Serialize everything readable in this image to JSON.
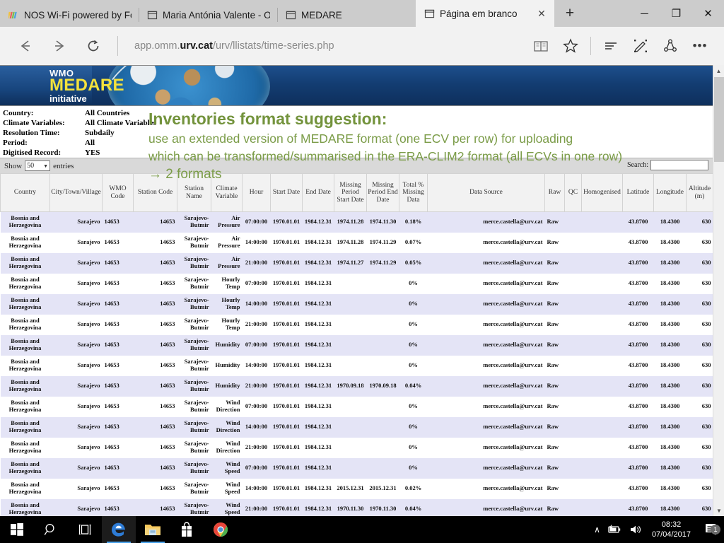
{
  "browser": {
    "tabs": [
      {
        "title": "NOS Wi-Fi powered by Fon",
        "icon": "colored-stripes-favicon",
        "active": false
      },
      {
        "title": "Maria Antónia Valente - Ou",
        "icon": "page-favicon",
        "active": false
      },
      {
        "title": "MEDARE",
        "icon": "page-favicon",
        "active": false
      },
      {
        "title": "Página em branco",
        "icon": "page-favicon",
        "active": true
      }
    ],
    "tab_close_label": "✕",
    "new_tab_label": "+",
    "window_controls": {
      "minimize": "─",
      "maximize": "❐",
      "close": "✕"
    },
    "nav": {
      "back": "back-arrow",
      "forward": "forward-arrow",
      "refresh": "refresh-arrow"
    },
    "address": {
      "prefix": "app.omm.",
      "bold": "urv.cat",
      "suffix": "/urv/llistats/time-series.php"
    },
    "toolbar_icons": [
      "reading-view-icon",
      "favorites-star-icon",
      "hub-icon",
      "web-note-icon",
      "share-icon",
      "more-icon"
    ],
    "more_label": "•••"
  },
  "banner": {
    "wmo": "WMO",
    "medare": "MEDARE",
    "initiative": "initiative"
  },
  "filters": [
    {
      "label": "Country:",
      "value": "All Countries"
    },
    {
      "label": "Climate Variables:",
      "value": "All Climate Variables"
    },
    {
      "label": "Resolution Time:",
      "value": "Subdaily"
    },
    {
      "label": "Period:",
      "value": "All"
    },
    {
      "label": "Digitised Record:",
      "value": "YES"
    }
  ],
  "overlay": {
    "title": "Inventories format suggestion:",
    "line1": "use an extended version of MEDARE format (one ECV per row) for uploading",
    "line2": "which can be transformed/summarised in the ERA-CLIM2 format (all ECVs in one row)",
    "line3": "→ 2 formats",
    "color": "#7b9c48"
  },
  "datatable": {
    "show_label": "Show",
    "entries_label": "entries",
    "page_length": "50",
    "caret": "▼",
    "search_label": "Search:",
    "search_value": "",
    "columns": [
      "Country",
      "City/Town/Village",
      "WMO Code",
      "Station Code",
      "Station Name",
      "Climate Variable",
      "Hour",
      "Start Date",
      "End Date",
      "Missing Period Start Date",
      "Missing Period End Date",
      "Total % Missing Data",
      "Data Source",
      "Raw",
      "QC",
      "Homogenised",
      "Latitude",
      "Longitude",
      "Altitude (m)"
    ],
    "rows": [
      [
        "Bosnia and Herzegovina",
        "Sarajevo",
        "14653",
        "14653",
        "Sarajevo-Butmir",
        "Air Pressure",
        "07:00:00",
        "1970.01.01",
        "1984.12.31",
        "1974.11.28",
        "1974.11.30",
        "0.18%",
        "merce.castella@urv.cat",
        "Raw",
        "",
        "",
        "43.8700",
        "18.4300",
        "630"
      ],
      [
        "Bosnia and Herzegovina",
        "Sarajevo",
        "14653",
        "14653",
        "Sarajevo-Butmir",
        "Air Pressure",
        "14:00:00",
        "1970.01.01",
        "1984.12.31",
        "1974.11.28",
        "1974.11.29",
        "0.07%",
        "merce.castella@urv.cat",
        "Raw",
        "",
        "",
        "43.8700",
        "18.4300",
        "630"
      ],
      [
        "Bosnia and Herzegovina",
        "Sarajevo",
        "14653",
        "14653",
        "Sarajevo-Butmir",
        "Air Pressure",
        "21:00:00",
        "1970.01.01",
        "1984.12.31",
        "1974.11.27",
        "1974.11.29",
        "0.05%",
        "merce.castella@urv.cat",
        "Raw",
        "",
        "",
        "43.8700",
        "18.4300",
        "630"
      ],
      [
        "Bosnia and Herzegovina",
        "Sarajevo",
        "14653",
        "14653",
        "Sarajevo-Butmir",
        "Hourly Temp",
        "07:00:00",
        "1970.01.01",
        "1984.12.31",
        "",
        "",
        "0%",
        "merce.castella@urv.cat",
        "Raw",
        "",
        "",
        "43.8700",
        "18.4300",
        "630"
      ],
      [
        "Bosnia and Herzegovina",
        "Sarajevo",
        "14653",
        "14653",
        "Sarajevo-Butmir",
        "Hourly Temp",
        "14:00:00",
        "1970.01.01",
        "1984.12.31",
        "",
        "",
        "0%",
        "merce.castella@urv.cat",
        "Raw",
        "",
        "",
        "43.8700",
        "18.4300",
        "630"
      ],
      [
        "Bosnia and Herzegovina",
        "Sarajevo",
        "14653",
        "14653",
        "Sarajevo-Butmir",
        "Hourly Temp",
        "21:00:00",
        "1970.01.01",
        "1984.12.31",
        "",
        "",
        "0%",
        "merce.castella@urv.cat",
        "Raw",
        "",
        "",
        "43.8700",
        "18.4300",
        "630"
      ],
      [
        "Bosnia and Herzegovina",
        "Sarajevo",
        "14653",
        "14653",
        "Sarajevo-Butmir",
        "Humidity",
        "07:00:00",
        "1970.01.01",
        "1984.12.31",
        "",
        "",
        "0%",
        "merce.castella@urv.cat",
        "Raw",
        "",
        "",
        "43.8700",
        "18.4300",
        "630"
      ],
      [
        "Bosnia and Herzegovina",
        "Sarajevo",
        "14653",
        "14653",
        "Sarajevo-Butmir",
        "Humidity",
        "14:00:00",
        "1970.01.01",
        "1984.12.31",
        "",
        "",
        "0%",
        "merce.castella@urv.cat",
        "Raw",
        "",
        "",
        "43.8700",
        "18.4300",
        "630"
      ],
      [
        "Bosnia and Herzegovina",
        "Sarajevo",
        "14653",
        "14653",
        "Sarajevo-Butmir",
        "Humidity",
        "21:00:00",
        "1970.01.01",
        "1984.12.31",
        "1970.09.18",
        "1970.09.18",
        "0.04%",
        "merce.castella@urv.cat",
        "Raw",
        "",
        "",
        "43.8700",
        "18.4300",
        "630"
      ],
      [
        "Bosnia and Herzegovina",
        "Sarajevo",
        "14653",
        "14653",
        "Sarajevo-Butmir",
        "Wind Direction",
        "07:00:00",
        "1970.01.01",
        "1984.12.31",
        "",
        "",
        "0%",
        "merce.castella@urv.cat",
        "Raw",
        "",
        "",
        "43.8700",
        "18.4300",
        "630"
      ],
      [
        "Bosnia and Herzegovina",
        "Sarajevo",
        "14653",
        "14653",
        "Sarajevo-Butmir",
        "Wind Direction",
        "14:00:00",
        "1970.01.01",
        "1984.12.31",
        "",
        "",
        "0%",
        "merce.castella@urv.cat",
        "Raw",
        "",
        "",
        "43.8700",
        "18.4300",
        "630"
      ],
      [
        "Bosnia and Herzegovina",
        "Sarajevo",
        "14653",
        "14653",
        "Sarajevo-Butmir",
        "Wind Direction",
        "21:00:00",
        "1970.01.01",
        "1984.12.31",
        "",
        "",
        "0%",
        "merce.castella@urv.cat",
        "Raw",
        "",
        "",
        "43.8700",
        "18.4300",
        "630"
      ],
      [
        "Bosnia and Herzegovina",
        "Sarajevo",
        "14653",
        "14653",
        "Sarajevo-Butmir",
        "Wind Speed",
        "07:00:00",
        "1970.01.01",
        "1984.12.31",
        "",
        "",
        "0%",
        "merce.castella@urv.cat",
        "Raw",
        "",
        "",
        "43.8700",
        "18.4300",
        "630"
      ],
      [
        "Bosnia and Herzegovina",
        "Sarajevo",
        "14653",
        "14653",
        "Sarajevo-Butmir",
        "Wind Speed",
        "14:00:00",
        "1970.01.01",
        "1984.12.31",
        "2015.12.31",
        "2015.12.31",
        "0.02%",
        "merce.castella@urv.cat",
        "Raw",
        "",
        "",
        "43.8700",
        "18.4300",
        "630"
      ],
      [
        "Bosnia and Herzegovina",
        "Sarajevo",
        "14653",
        "14653",
        "Sarajevo-Butmir",
        "Wind Speed",
        "21:00:00",
        "1970.01.01",
        "1984.12.31",
        "1970.11.30",
        "1970.11.30",
        "0.04%",
        "merce.castella@urv.cat",
        "Raw",
        "",
        "",
        "43.8700",
        "18.4300",
        "630"
      ]
    ]
  },
  "taskbar": {
    "items": [
      "start-icon",
      "search-icon",
      "task-view-icon",
      "edge-icon",
      "file-explorer-icon",
      "store-icon",
      "chrome-icon"
    ],
    "tray": {
      "chevron": "∧",
      "battery": "battery-icon",
      "volume": "volume-icon"
    },
    "clock": {
      "time": "08:32",
      "date": "07/04/2017"
    },
    "notification_count": "1"
  }
}
